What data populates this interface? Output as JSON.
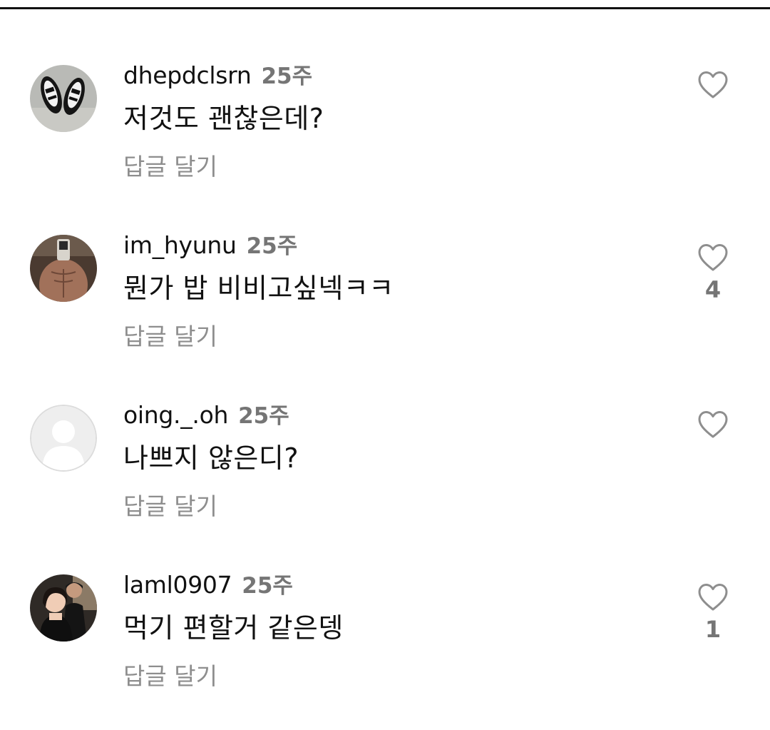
{
  "comments": [
    {
      "username": "dhepdclsrn",
      "time": "25주",
      "text": "저것도 괜찮은데?",
      "reply_label": "답글 달기",
      "like_count": "",
      "avatar": "sneakers-photo"
    },
    {
      "username": "im_hyunu",
      "time": "25주",
      "text": "뭔가 밥 비비고싶넥ㅋㅋ",
      "reply_label": "답글 달기",
      "like_count": "4",
      "avatar": "mirror-selfie-photo"
    },
    {
      "username": "oing._.oh",
      "time": "25주",
      "text": "나쁘지 않은디?",
      "reply_label": "답글 달기",
      "like_count": "",
      "avatar": "default-avatar"
    },
    {
      "username": "laml0907",
      "time": "25주",
      "text": "먹기 편할거 같은뎅",
      "reply_label": "답글 달기",
      "like_count": "1",
      "avatar": "couple-photo"
    }
  ],
  "colors": {
    "username": "#111111",
    "time": "#757575",
    "reply": "#8e8e8e",
    "heart_outline": "#8e8e8e",
    "divider": "#111111"
  },
  "icons": {
    "like": "heart-outline-icon"
  }
}
